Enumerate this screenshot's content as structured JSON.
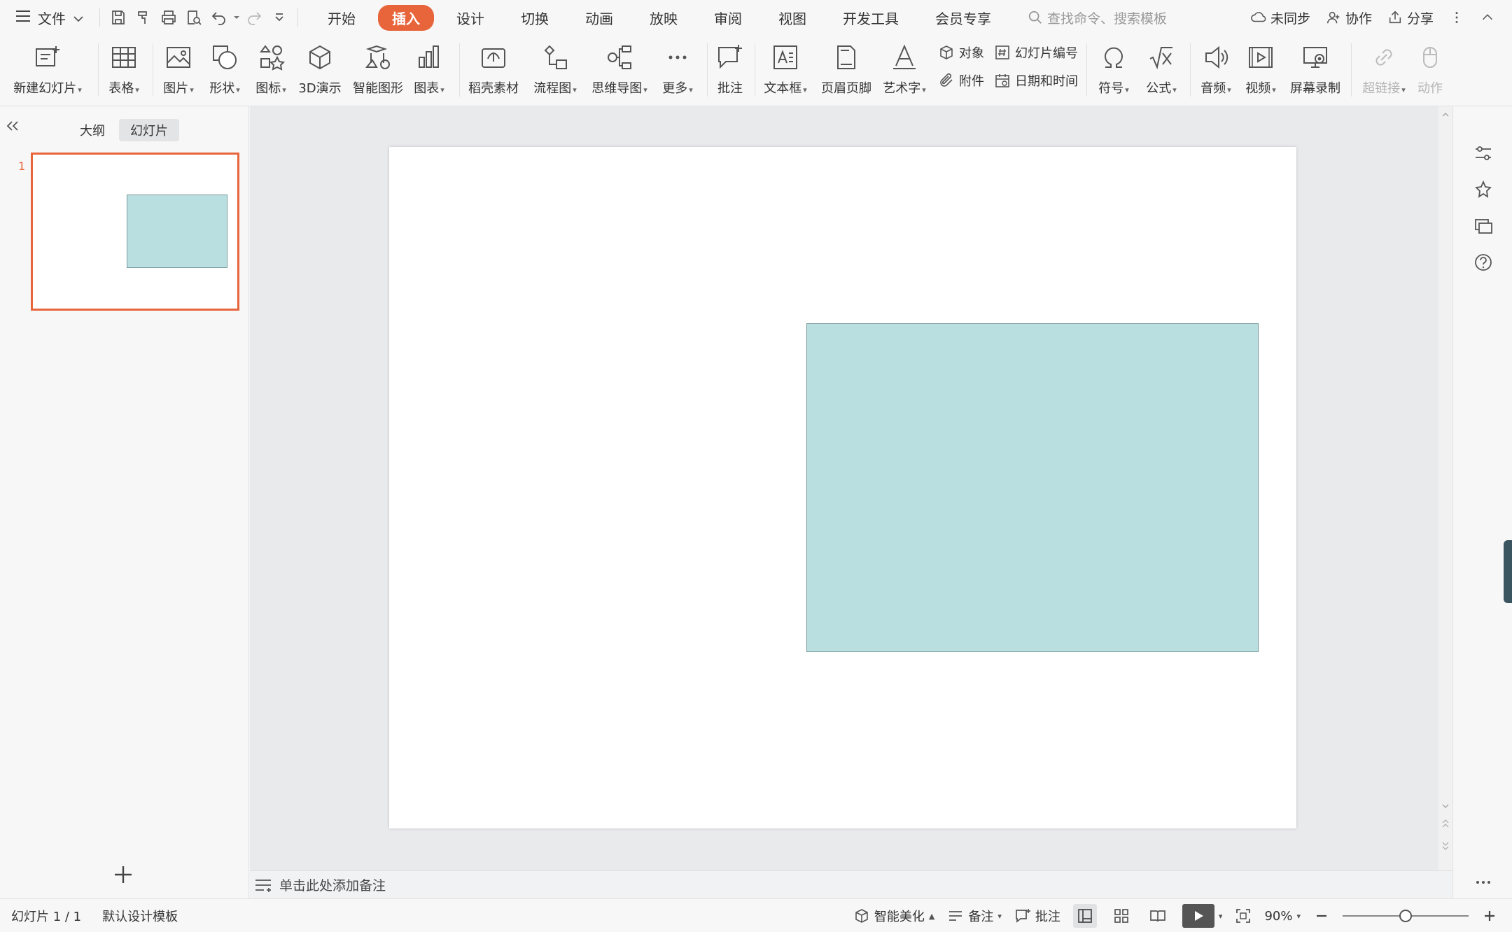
{
  "menubar": {
    "file_label": "文件",
    "tabs": [
      "开始",
      "插入",
      "设计",
      "切换",
      "动画",
      "放映",
      "审阅",
      "视图",
      "开发工具",
      "会员专享"
    ],
    "active_tab": "插入",
    "search_placeholder": "查找命令、搜索模板",
    "sync_label": "未同步",
    "collab_label": "协作",
    "share_label": "分享"
  },
  "ribbon": {
    "new_slide": "新建幻灯片",
    "table": "表格",
    "picture": "图片",
    "shape": "形状",
    "icon": "图标",
    "demo3d": "3D演示",
    "smartart": "智能图形",
    "chart": "图表",
    "material": "稻壳素材",
    "flowchart": "流程图",
    "mindmap": "思维导图",
    "more": "更多",
    "comment": "批注",
    "textbox": "文本框",
    "header_footer": "页眉页脚",
    "wordart": "艺术字",
    "object": "对象",
    "slide_number": "幻灯片编号",
    "attachment": "附件",
    "datetime": "日期和时间",
    "symbol": "符号",
    "formula": "公式",
    "audio": "音频",
    "video": "视频",
    "screen_record": "屏幕录制",
    "hyperlink": "超链接",
    "action": "动作"
  },
  "leftpanel": {
    "outline_tab": "大纲",
    "slides_tab": "幻灯片",
    "slide_number": "1"
  },
  "notes": {
    "placeholder": "单击此处添加备注"
  },
  "statusbar": {
    "slide_info": "幻灯片 1 / 1",
    "template": "默认设计模板",
    "beautify": "智能美化",
    "notes": "备注",
    "comments": "批注",
    "zoom": "90%"
  },
  "colors": {
    "accent": "#e8643a",
    "shape_fill": "#badfe1",
    "shape_border": "#7a9a9b"
  }
}
